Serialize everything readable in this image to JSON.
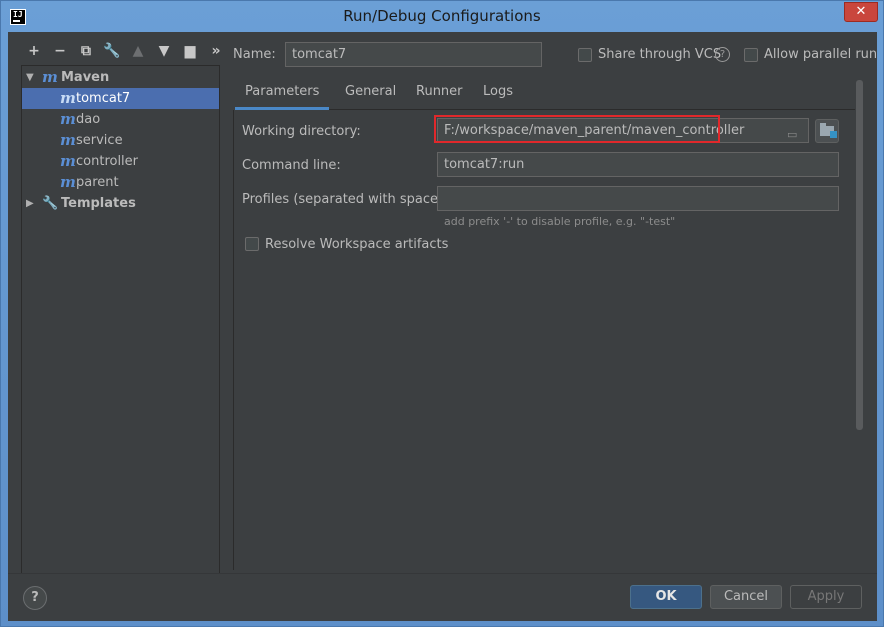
{
  "window": {
    "title": "Run/Debug Configurations",
    "app_icon": "IJ",
    "close": "✕"
  },
  "toolbar": {
    "add": "+",
    "remove": "−",
    "copy": "⧉",
    "edit": "🔧",
    "up": "▲",
    "down": "▼",
    "folder": "📁",
    "more": "»"
  },
  "tree": {
    "group": "Maven",
    "items": [
      {
        "label": "tomcat7",
        "selected": true
      },
      {
        "label": "dao"
      },
      {
        "label": "service"
      },
      {
        "label": "controller"
      },
      {
        "label": "parent"
      }
    ],
    "templates": "Templates"
  },
  "header": {
    "name_label": "Name:",
    "name_value": "tomcat7",
    "share_vcs": "Share through VCS",
    "allow_parallel": "Allow parallel run",
    "help": "?"
  },
  "tabs": [
    {
      "label": "Parameters",
      "active": true
    },
    {
      "label": "General"
    },
    {
      "label": "Runner"
    },
    {
      "label": "Logs"
    }
  ],
  "params": {
    "working_dir_label": "Working directory:",
    "working_dir_value": "F:/workspace/maven_parent/maven_controller",
    "command_line_label": "Command line:",
    "command_line_value": "tomcat7:run",
    "profiles_label": "Profiles (separated with space):",
    "profiles_value": "",
    "profiles_hint": "add prefix '-' to disable profile, e.g. \"-test\"",
    "resolve_label": "Resolve Workspace artifacts"
  },
  "buttons": {
    "help": "?",
    "ok": "OK",
    "cancel": "Cancel",
    "apply": "Apply"
  },
  "colors": {
    "accent": "#4b6eaf",
    "highlight_box": "#e1282b",
    "background": "#3c3f41"
  }
}
